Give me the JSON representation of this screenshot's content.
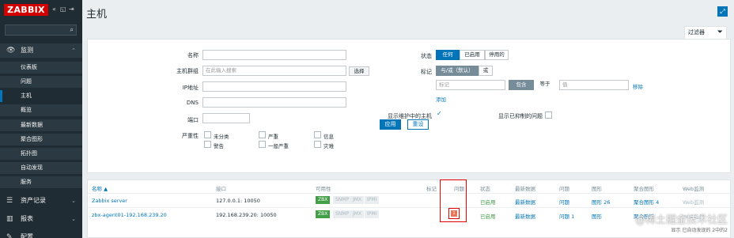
{
  "sidebar": {
    "logo": "ZABBIX",
    "menu": [
      {
        "label": "监测",
        "icon": "eye-icon",
        "expanded": true
      },
      {
        "label": "资产记录",
        "icon": "list-icon"
      },
      {
        "label": "报表",
        "icon": "chart-icon"
      },
      {
        "label": "配置",
        "icon": "wrench-icon"
      }
    ],
    "submenu": [
      "仪表板",
      "问题",
      "主机",
      "概览",
      "最新数据",
      "聚合图形",
      "拓扑图",
      "自动发现",
      "服务"
    ],
    "selected_index": 2
  },
  "header": {
    "title": "主机",
    "filter_tab": "过滤器"
  },
  "filter": {
    "name_label": "名称",
    "hostgroups_label": "主机群组",
    "hostgroups_placeholder": "在此输入搜索",
    "select_button": "选择",
    "ip_label": "IP地址",
    "dns_label": "DNS",
    "port_label": "端口",
    "severity_label": "严重性",
    "severities": [
      "未分类",
      "警告",
      "一般严重",
      "信息",
      "严重",
      "灾难"
    ],
    "status_label": "状态",
    "status_options": [
      "任何",
      "已启用",
      "停用的"
    ],
    "tags_label": "标记",
    "tags_options": [
      "与/或（默认）",
      "或"
    ],
    "tag_placeholder": "标记",
    "tag_op": "包含",
    "tag_op2": "等于",
    "tag_value_placeholder": "值",
    "tag_remove": "移除",
    "tag_add": "添加",
    "maint_label": "显示维护中的主机",
    "suppressed_label": "显示已抑制的问题",
    "apply_button": "应用",
    "reset_button": "重设"
  },
  "table": {
    "headers": [
      "名称 ▲",
      "接口",
      "可用性",
      "标记",
      "问题",
      "状态",
      "最新数据",
      "问题",
      "图形",
      "聚合图形",
      "Web监测"
    ],
    "rows": [
      {
        "name": "Zabbix server",
        "interface": "127.0.0.1: 10050",
        "avail": [
          "ZBX",
          "SNMP",
          "JMX",
          "IPMI"
        ],
        "status": "已启用",
        "latest": "最新数据",
        "problems": "问题",
        "graphs": "图形 26",
        "screens": "聚合图形 4",
        "web": "Web监测"
      },
      {
        "name": "zbx-agent01-192.168.239.20",
        "interface": "192.168.239.20: 10050",
        "avail": [
          "ZBX",
          "SNMP",
          "JMX",
          "IPMI"
        ],
        "problem_badge": "1",
        "status": "已启用",
        "latest": "最新数据",
        "problems": "问题 1",
        "graphs": "图形",
        "screens": "聚合图形",
        "web": "Web监测"
      }
    ]
  },
  "watermark": {
    "line1": "@稀土掘金技术社区",
    "line2": "显示 已自动发现的 2中的2"
  }
}
